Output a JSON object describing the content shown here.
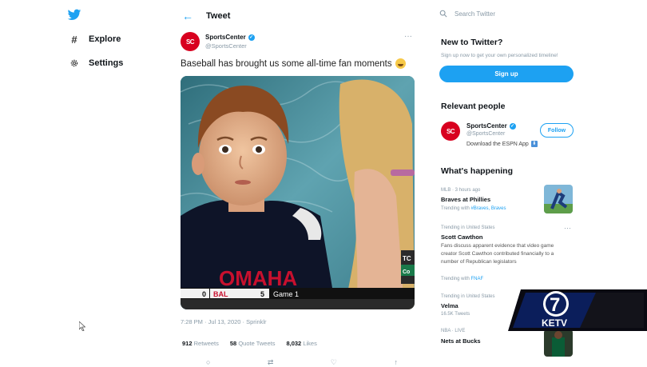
{
  "nav": {
    "logo": "twitter-bird-icon",
    "items": [
      {
        "label": "Explore",
        "icon": "hashtag-icon"
      },
      {
        "label": "Settings",
        "icon": "gear-icon"
      }
    ]
  },
  "header": {
    "title": "Tweet"
  },
  "tweet": {
    "author_name": "SportsCenter",
    "author_handle": "@SportsCenter",
    "avatar_text": "SC",
    "text": "Baseball has brought us some all-time fan moments",
    "scoreboard": {
      "left_score": "0",
      "team": "BAL",
      "team_score": "5",
      "game": "Game 1"
    },
    "side_text_1": "TC",
    "side_text_2": "Co",
    "shirt_text": "OMAHA",
    "timestamp": "7:28 PM · Jul 13, 2020 · Sprinklr",
    "retweets_count": "912",
    "retweets_label": "Retweets",
    "quote_count": "58",
    "quote_label": "Quote Tweets",
    "likes_count": "8,032",
    "likes_label": "Likes"
  },
  "sidebar": {
    "search_placeholder": "Search Twitter",
    "new_title": "New to Twitter?",
    "new_sub": "Sign up now to get your own personalized timeline!",
    "signup_label": "Sign up",
    "relevant_title": "Relevant people",
    "person": {
      "name": "SportsCenter",
      "handle": "@SportsCenter",
      "bio": "Download the ESPN App",
      "follow_label": "Follow",
      "avatar_text": "SC"
    },
    "happening_title": "What's happening",
    "trends": [
      {
        "meta": "MLB · 3 hours ago",
        "title": "Braves at Phillies",
        "foot_prefix": "Trending with ",
        "foot_links": "#Braves, Braves"
      },
      {
        "meta": "Trending in United States",
        "title": "Scott Cawthon",
        "desc": "Fans discuss apparent evidence that video game creator Scott Cawthon contributed financially to a number of Republican legislators",
        "foot_prefix": "Trending with ",
        "foot_links": "FNAF"
      },
      {
        "meta": "Trending in United States",
        "title": "Velma",
        "foot": "16.5K Tweets"
      },
      {
        "meta": "NBA · LIVE",
        "title": "Nets at Bucks"
      }
    ]
  },
  "overlay": {
    "channel_number": "7",
    "station": "KETV"
  },
  "colors": {
    "accent": "#1da1f2",
    "brand_red": "#d8001f",
    "ketv_blue": "#0b1e5b"
  }
}
